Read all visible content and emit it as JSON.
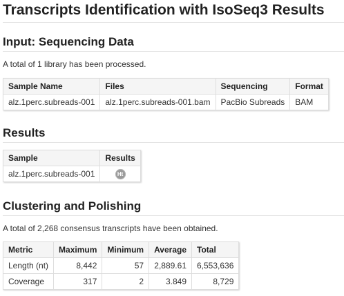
{
  "title": "Transcripts Identification with IsoSeq3 Results",
  "input": {
    "heading": "Input: Sequencing Data",
    "summary": "A total of 1 library has been processed.",
    "headers": [
      "Sample Name",
      "Files",
      "Sequencing",
      "Format"
    ],
    "rows": [
      [
        "alz.1perc.subreads-001",
        "alz.1perc.subreads-001.bam",
        "PacBio Subreads",
        "BAM"
      ]
    ]
  },
  "results": {
    "heading": "Results",
    "headers": [
      "Sample",
      "Results"
    ],
    "rows": [
      {
        "sample": "alz.1perc.subreads-001",
        "result_icon": "html-report-icon",
        "result_icon_text": "Ht"
      }
    ]
  },
  "clustering": {
    "heading": "Clustering and Polishing",
    "summary": "A total of 2,268 consensus transcripts have been obtained.",
    "headers": [
      "Metric",
      "Maximum",
      "Minimum",
      "Average",
      "Total"
    ],
    "rows": [
      [
        "Length (nt)",
        "8,442",
        "57",
        "2,889.61",
        "6,553,636"
      ],
      [
        "Coverage",
        "317",
        "2",
        "3.849",
        "8,729"
      ]
    ]
  }
}
